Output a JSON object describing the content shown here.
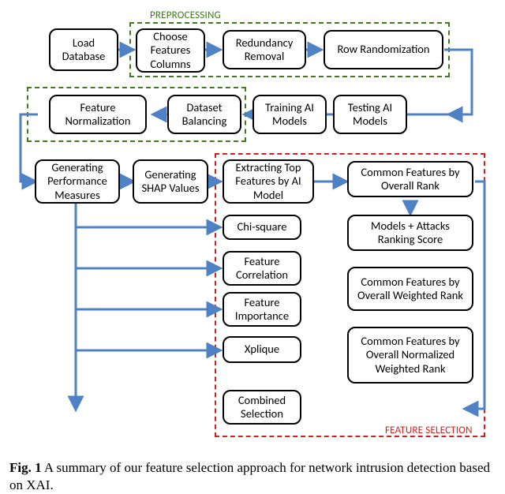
{
  "labels": {
    "preprocessing": "PREPROCESSING",
    "featureSelection": "FEATURE SELECTION"
  },
  "boxes": {
    "loadDb": "Load Database",
    "chooseFeat": "Choose Features Columns",
    "redundancy": "Redundancy Removal",
    "rowRand": "Row Randomization",
    "featNorm": "Feature Normalization",
    "dsBalance": "Dataset Balancing",
    "trainAI": "Training AI Models",
    "testAI": "Testing AI Models",
    "genPerf": "Generating Performance Measures",
    "genSHAP": "Generating SHAP Values",
    "extractTop": "Extracting Top Features by AI Model",
    "chiSq": "Chi-square",
    "featCorr": "Feature Correlation",
    "featImp": "Feature Importance",
    "xplique": "Xplique",
    "combined": "Combined Selection",
    "cfOverall": "Common Features by Overall Rank",
    "maRank": "Models + Attacks Ranking Score",
    "cfWeighted": "Common Features by Overall Weighted Rank",
    "cfNormWeighted": "Common Features by Overall Normalized Weighted Rank"
  },
  "caption": {
    "figNum": "Fig. 1",
    "text": "  A summary of our feature selection approach for network intrusion detection based on XAI."
  }
}
